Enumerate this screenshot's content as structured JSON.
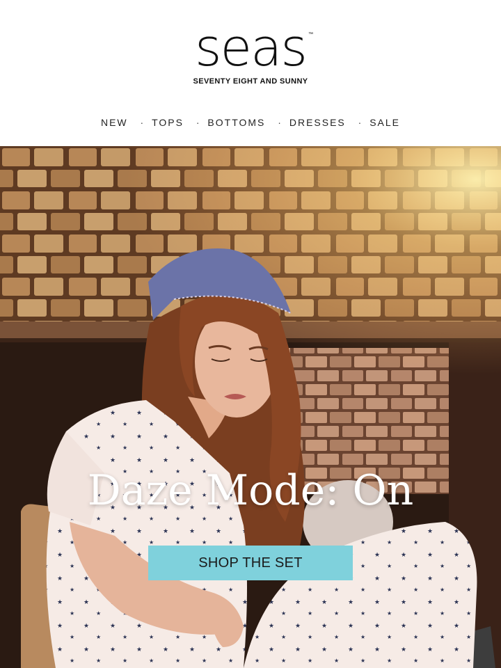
{
  "brand": {
    "logo_text": "seas",
    "trademark": "™",
    "tagline": "SEVENTY EIGHT AND SUNNY"
  },
  "nav": {
    "items": [
      {
        "label": "NEW"
      },
      {
        "label": "TOPS"
      },
      {
        "label": "BOTTOMS"
      },
      {
        "label": "DRESSES"
      },
      {
        "label": "SALE"
      }
    ],
    "separator": "·"
  },
  "hero": {
    "headline": "Daze Mode: On",
    "cta_label": "SHOP THE SET",
    "image_icon": "photo-woman-in-star-print-pajamas",
    "colors": {
      "brick": "#a8764d",
      "cta": "#7fd1dc",
      "headline": "#ffffff"
    }
  }
}
